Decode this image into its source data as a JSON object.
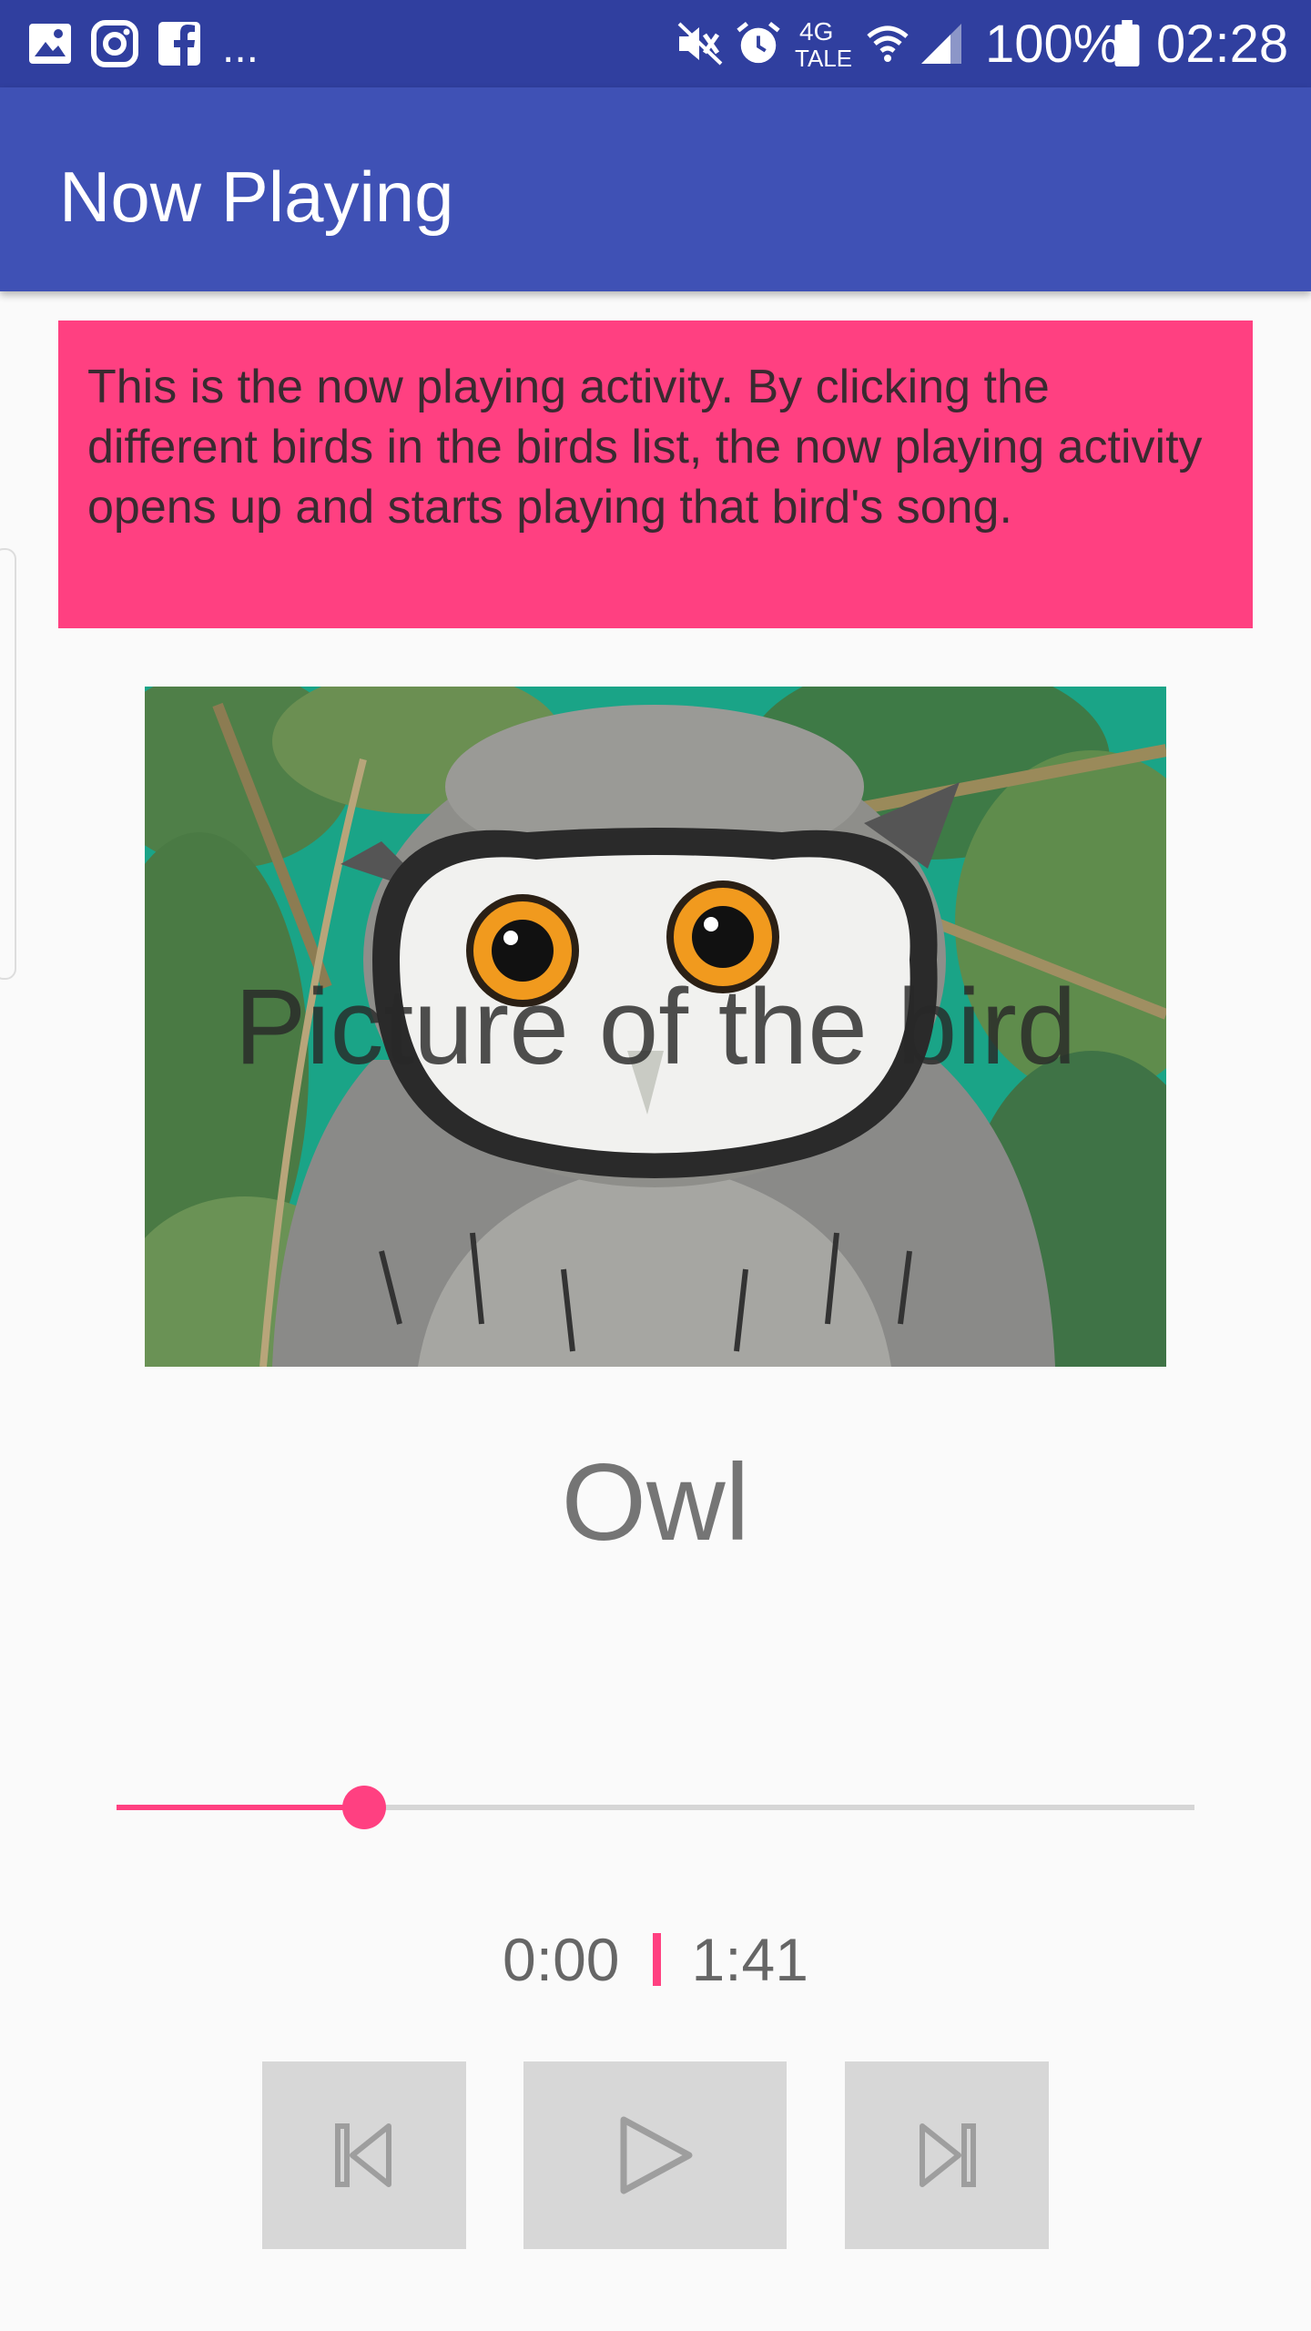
{
  "status_bar": {
    "left_icons": [
      "gallery-icon",
      "instagram-icon",
      "facebook-icon"
    ],
    "more": "...",
    "network": "4G",
    "carrier": "TALE",
    "battery": "100%",
    "time": "02:28"
  },
  "app_bar": {
    "title": "Now Playing"
  },
  "info": {
    "text": "This is the now playing activity. By clicking the different birds in the birds list, the now playing activity opens up and starts playing that bird's song."
  },
  "picture": {
    "caption": "Picture of the bird"
  },
  "bird": {
    "name": "Owl"
  },
  "player": {
    "progress_fraction": 0.23,
    "current_time": "0:00",
    "total_time": "1:41",
    "buttons": [
      "previous-icon",
      "play-icon",
      "next-icon"
    ]
  },
  "colors": {
    "status_bar": "#303F9F",
    "app_bar": "#3F51B5",
    "accent": "#FF4081",
    "control_bg": "#D7D7D7"
  }
}
